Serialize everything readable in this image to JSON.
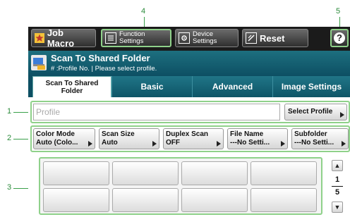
{
  "callouts": {
    "c1": "1",
    "c2": "2",
    "c3": "3",
    "c4": "4",
    "c5": "5"
  },
  "toolbar": {
    "job_macro": "Job Macro",
    "function_settings": [
      "Function",
      "Settings"
    ],
    "device_settings": [
      "Device",
      "Settings"
    ],
    "reset": "Reset",
    "help": "?"
  },
  "header": {
    "title": "Scan To Shared Folder",
    "subtitle": "# :Profile No. | Please select profile."
  },
  "tabs": [
    {
      "label_line1": "Scan To Shared",
      "label_line2": "Folder",
      "active": true
    },
    {
      "label": "Basic"
    },
    {
      "label": "Advanced"
    },
    {
      "label": "Image Settings"
    }
  ],
  "profile": {
    "placeholder": "Profile",
    "select_button": "Select Profile"
  },
  "settings": [
    {
      "name": "Color Mode",
      "value": "Auto (Colo..."
    },
    {
      "name": "Scan Size",
      "value": "Auto"
    },
    {
      "name": "Duplex Scan",
      "value": "OFF"
    },
    {
      "name": "File Name",
      "value": "---No Setti..."
    },
    {
      "name": "Subfolder",
      "value": "---No Setti..."
    }
  ],
  "pager": {
    "current": "1",
    "total": "5",
    "up_icon": "▲",
    "down_icon": "▼"
  },
  "colors": {
    "accent_green": "#8fd18a",
    "title_teal": "#0d4f63"
  }
}
